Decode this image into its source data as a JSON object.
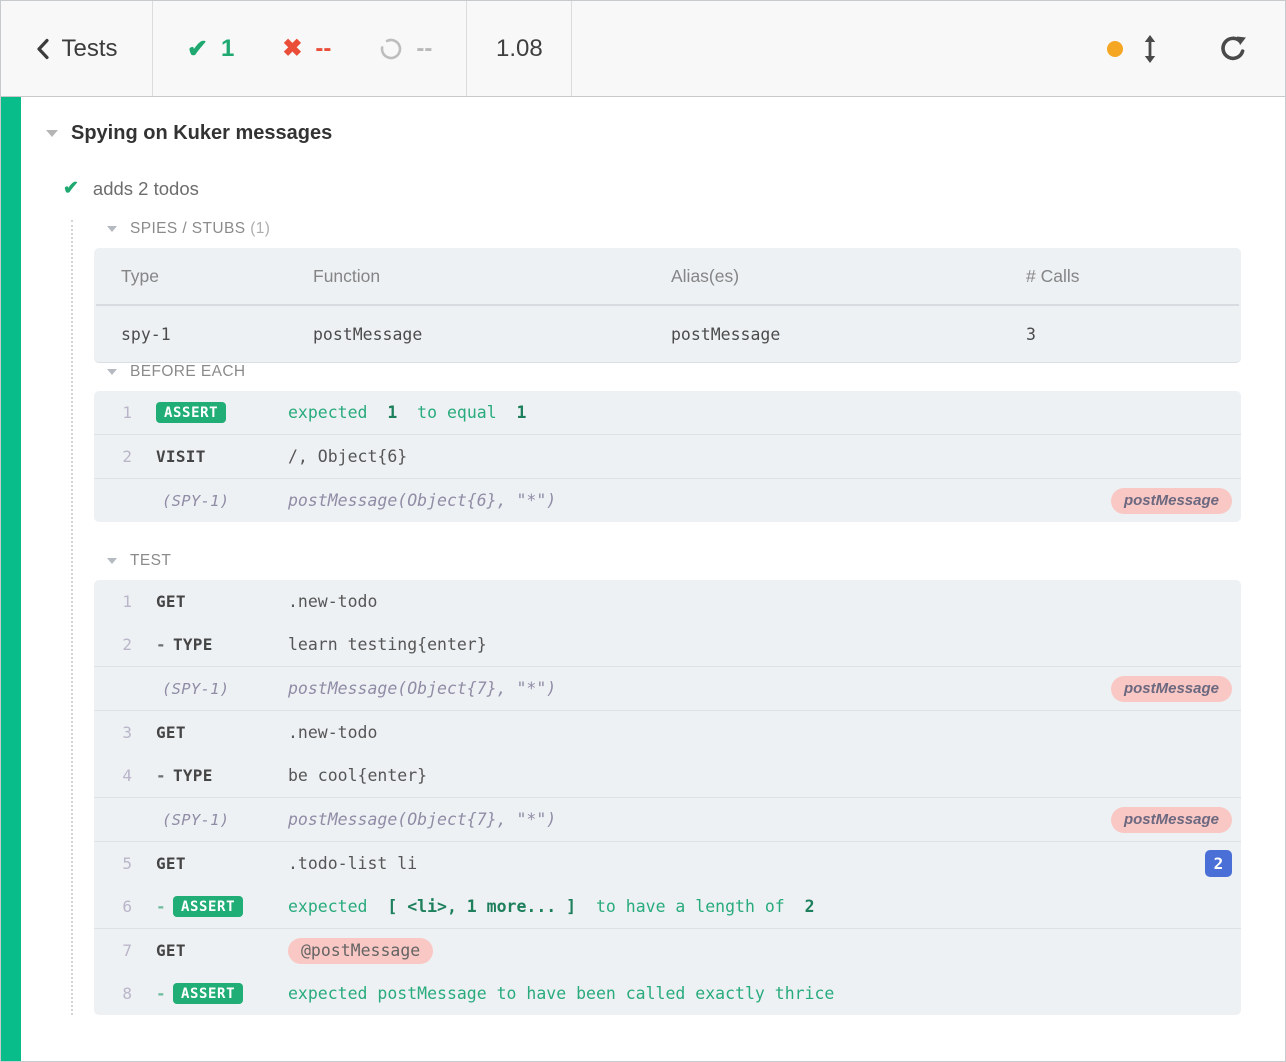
{
  "header": {
    "back_label": "Tests",
    "stats": {
      "passed": "1",
      "failed": "--",
      "pending": "--"
    },
    "duration": "1.08",
    "colors": {
      "passed": "#1fa971",
      "failed": "#ea4e39",
      "pending": "#b9b9b9",
      "indicator_dot": "#f5a623"
    }
  },
  "suite": {
    "title": "Spying on Kuker messages"
  },
  "test": {
    "title": "adds 2 todos"
  },
  "instruments": {
    "title": "SPIES / STUBS",
    "count": "(1)",
    "columns": [
      "Type",
      "Function",
      "Alias(es)",
      "# Calls"
    ],
    "rows": [
      {
        "type": "spy-1",
        "function": "postMessage",
        "alias": "postMessage",
        "calls": "3"
      }
    ]
  },
  "sections": [
    {
      "title": "BEFORE EACH",
      "groups": [
        {
          "rows": [
            {
              "num": "1",
              "type": "assert",
              "badge": "ASSERT",
              "parts": [
                [
                  "expected ",
                  0
                ],
                [
                  " 1 ",
                  1
                ],
                [
                  " to equal ",
                  0
                ],
                [
                  " 1",
                  1
                ]
              ]
            }
          ]
        },
        {
          "rows": [
            {
              "num": "2",
              "type": "cmd",
              "method": "VISIT",
              "msg": "/, Object{6}"
            }
          ]
        },
        {
          "rows": [
            {
              "type": "spy",
              "label": "(SPY-1)",
              "msg": "postMessage(Object{6}, \"*\")",
              "right_pill": "postMessage"
            }
          ]
        }
      ]
    },
    {
      "title": "TEST",
      "groups": [
        {
          "rows": [
            {
              "num": "1",
              "type": "cmd",
              "method": "GET",
              "msg": ".new-todo"
            },
            {
              "num": "2",
              "type": "cmd",
              "dash": true,
              "method": "TYPE",
              "msg": "learn testing{enter}"
            }
          ]
        },
        {
          "rows": [
            {
              "type": "spy",
              "label": "(SPY-1)",
              "msg": "postMessage(Object{7}, \"*\")",
              "right_pill": "postMessage"
            }
          ]
        },
        {
          "rows": [
            {
              "num": "3",
              "type": "cmd",
              "method": "GET",
              "msg": ".new-todo"
            },
            {
              "num": "4",
              "type": "cmd",
              "dash": true,
              "method": "TYPE",
              "msg": "be cool{enter}"
            }
          ]
        },
        {
          "rows": [
            {
              "type": "spy",
              "label": "(SPY-1)",
              "msg": "postMessage(Object{7}, \"*\")",
              "right_pill": "postMessage"
            }
          ]
        },
        {
          "rows": [
            {
              "num": "5",
              "type": "cmd",
              "method": "GET",
              "msg": ".todo-list li",
              "right_count": "2"
            },
            {
              "num": "6",
              "type": "assert",
              "dash": true,
              "badge": "ASSERT",
              "parts": [
                [
                  "expected ",
                  0
                ],
                [
                  " [ <li>, 1 more... ] ",
                  1
                ],
                [
                  " to have a length of ",
                  0
                ],
                [
                  " 2",
                  1
                ]
              ]
            }
          ]
        },
        {
          "rows": [
            {
              "num": "7",
              "type": "cmd",
              "method": "GET",
              "msg": "@postMessage",
              "msg_pill": true
            },
            {
              "num": "8",
              "type": "assert",
              "dash": true,
              "badge": "ASSERT",
              "parts": [
                [
                  "expected postMessage to have been called exactly thrice",
                  0
                ]
              ]
            }
          ]
        }
      ]
    }
  ]
}
